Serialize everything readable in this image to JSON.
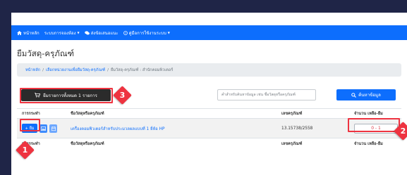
{
  "navbar": {
    "home": "หน้าหลัก",
    "booking": "ระบบการจองห้อง",
    "feedback": "ส่งข้อเสนอแนะ",
    "manual": "คู่มือการใช้งานระบบ"
  },
  "page": {
    "title": "ยืมวัสดุ-ครุภัณฑ์"
  },
  "breadcrumb": {
    "home": "หน้าหลัก",
    "select_unit": "เลือกหน่วยงานเพื่อยืมวัสดุ-ครุภัณฑ์",
    "current": "ยืมวัสดุ-ครุภัณฑ์ : สำนักคอมพิวเตอร์"
  },
  "toolbar": {
    "borrow_all_label": "ยืมรายการทั้งหมด 1 รายการ",
    "search_placeholder": "คำสำหรับค้นหาข้อมูล เช่น ชื่อวัสดุหรือครุภัณฑ์",
    "search_label": "ค้นหาข้อมูล"
  },
  "table": {
    "headers": [
      "การกระทำ",
      "ชื่อวัสดุหรือครุภัณฑ์",
      "เลขครุภัณฑ์",
      "จำนวน เหลือ-ยืม"
    ],
    "rows": [
      {
        "borrow_label": "+ ยืม",
        "name": "เครื่องคอมพิวเตอร์สำหรับประมวลผลแบบที่ 1 ยี่ห้อ HP",
        "code": "13.15738/2558",
        "remaining_borrowed": "0 - 1"
      }
    ]
  },
  "annotations": {
    "badge1": "1",
    "badge2": "2",
    "badge3": "3"
  },
  "colors": {
    "page_bg": "#1f2547",
    "primary": "#0d6efd",
    "dark_button": "#2b2b2b",
    "annotation": "#ee3340",
    "status_text": "#dc3545"
  }
}
